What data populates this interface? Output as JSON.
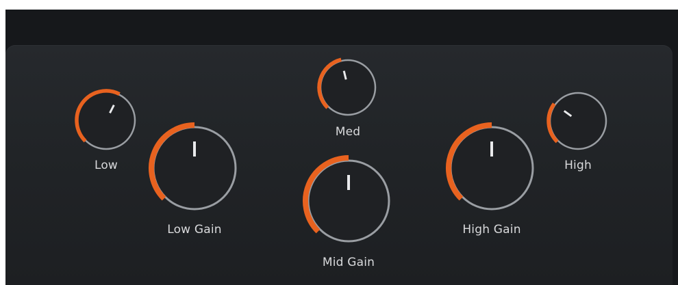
{
  "theme": {
    "arc_color": "#e8621f",
    "ring_color": "#9a9ea3",
    "indicator_color": "#e9eaec",
    "label_color": "#d9dadc"
  },
  "knobs": [
    {
      "id": "low",
      "label": "Low",
      "value": 0.6
    },
    {
      "id": "low_gain",
      "label": "Low Gain",
      "value": 0.5
    },
    {
      "id": "med",
      "label": "Med",
      "value": 0.45
    },
    {
      "id": "mid_gain",
      "label": "Mid Gain",
      "value": 0.5
    },
    {
      "id": "high_gain",
      "label": "High Gain",
      "value": 0.5
    },
    {
      "id": "high",
      "label": "High",
      "value": 0.3
    }
  ]
}
